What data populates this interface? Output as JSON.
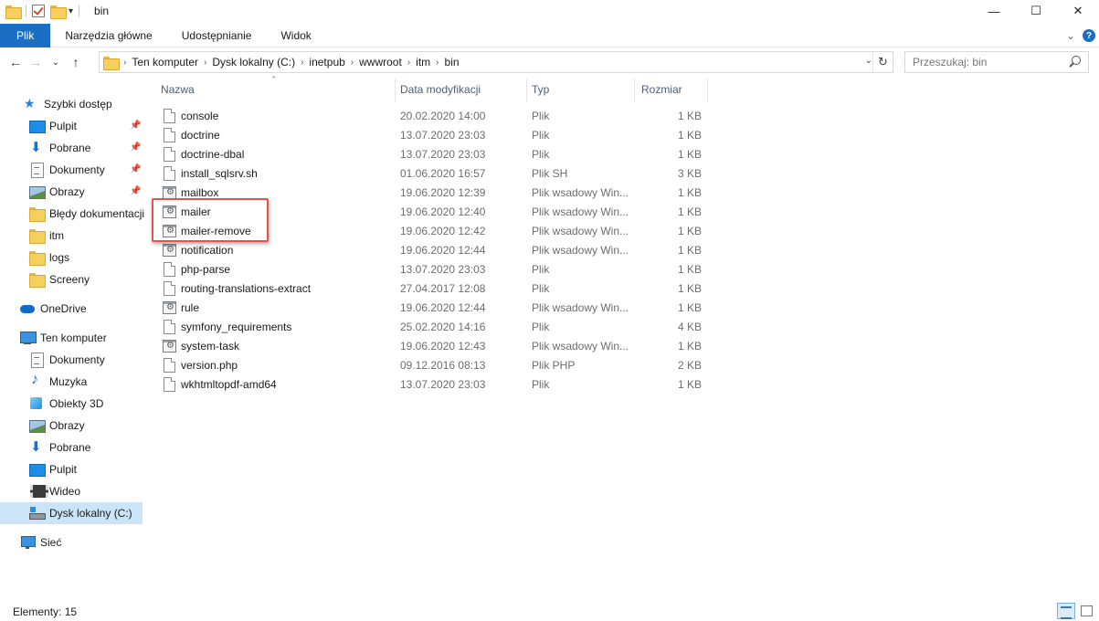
{
  "window": {
    "title": "bin",
    "buttons": {
      "minimize": "—",
      "maximize": "☐",
      "close": "✕"
    }
  },
  "ribbon": {
    "tabs": [
      "Plik",
      "Narzędzia główne",
      "Udostępnianie",
      "Widok"
    ],
    "expand_icon": "⌄",
    "help_icon": "?"
  },
  "nav": {
    "back": "←",
    "forward": "→",
    "recent": "⌄",
    "up": "↑"
  },
  "address": {
    "crumbs": [
      "Ten komputer",
      "Dysk lokalny (C:)",
      "inetpub",
      "wwwroot",
      "itm",
      "bin"
    ],
    "separator": "›",
    "dropdown": "⌄",
    "refresh": "↻"
  },
  "search": {
    "placeholder": "Przeszukaj: bin"
  },
  "sidebar": {
    "quick_access": "Szybki dostęp",
    "quick_items": [
      {
        "label": "Pulpit",
        "icon": "desktop-icon",
        "pinned": true
      },
      {
        "label": "Pobrane",
        "icon": "downloads-icon",
        "pinned": true
      },
      {
        "label": "Dokumenty",
        "icon": "documents-icon",
        "pinned": true
      },
      {
        "label": "Obrazy",
        "icon": "pictures-icon",
        "pinned": true
      },
      {
        "label": "Błędy dokumentacji",
        "icon": "folder-icon",
        "pinned": false
      },
      {
        "label": "itm",
        "icon": "folder-icon",
        "pinned": false
      },
      {
        "label": "logs",
        "icon": "folder-icon",
        "pinned": false
      },
      {
        "label": "Screeny",
        "icon": "folder-icon",
        "pinned": false
      }
    ],
    "onedrive": "OneDrive",
    "this_pc": "Ten komputer",
    "pc_items": [
      {
        "label": "Dokumenty",
        "icon": "documents-icon"
      },
      {
        "label": "Muzyka",
        "icon": "music-icon"
      },
      {
        "label": "Obiekty 3D",
        "icon": "3d-objects-icon"
      },
      {
        "label": "Obrazy",
        "icon": "pictures-icon"
      },
      {
        "label": "Pobrane",
        "icon": "downloads-icon"
      },
      {
        "label": "Pulpit",
        "icon": "desktop-icon"
      },
      {
        "label": "Wideo",
        "icon": "video-icon"
      },
      {
        "label": "Dysk lokalny (C:)",
        "icon": "drive-icon"
      }
    ],
    "network": "Sieć",
    "pin_glyph": "📌"
  },
  "columns": {
    "name": "Nazwa",
    "date": "Data modyfikacji",
    "type": "Typ",
    "size": "Rozmiar"
  },
  "files": [
    {
      "name": "console",
      "date": "20.02.2020 14:00",
      "type": "Plik",
      "size": "1 KB",
      "kind": "file"
    },
    {
      "name": "doctrine",
      "date": "13.07.2020 23:03",
      "type": "Plik",
      "size": "1 KB",
      "kind": "file"
    },
    {
      "name": "doctrine-dbal",
      "date": "13.07.2020 23:03",
      "type": "Plik",
      "size": "1 KB",
      "kind": "file"
    },
    {
      "name": "install_sqlsrv.sh",
      "date": "01.06.2020 16:57",
      "type": "Plik SH",
      "size": "3 KB",
      "kind": "file"
    },
    {
      "name": "mailbox",
      "date": "19.06.2020 12:39",
      "type": "Plik wsadowy Win...",
      "size": "1 KB",
      "kind": "batch"
    },
    {
      "name": "mailer",
      "date": "19.06.2020 12:40",
      "type": "Plik wsadowy Win...",
      "size": "1 KB",
      "kind": "batch"
    },
    {
      "name": "mailer-remove",
      "date": "19.06.2020 12:42",
      "type": "Plik wsadowy Win...",
      "size": "1 KB",
      "kind": "batch"
    },
    {
      "name": "notification",
      "date": "19.06.2020 12:44",
      "type": "Plik wsadowy Win...",
      "size": "1 KB",
      "kind": "batch"
    },
    {
      "name": "php-parse",
      "date": "13.07.2020 23:03",
      "type": "Plik",
      "size": "1 KB",
      "kind": "file"
    },
    {
      "name": "routing-translations-extract",
      "date": "27.04.2017 12:08",
      "type": "Plik",
      "size": "1 KB",
      "kind": "file"
    },
    {
      "name": "rule",
      "date": "19.06.2020 12:44",
      "type": "Plik wsadowy Win...",
      "size": "1 KB",
      "kind": "batch"
    },
    {
      "name": "symfony_requirements",
      "date": "25.02.2020 14:16",
      "type": "Plik",
      "size": "4 KB",
      "kind": "file"
    },
    {
      "name": "system-task",
      "date": "19.06.2020 12:43",
      "type": "Plik wsadowy Win...",
      "size": "1 KB",
      "kind": "batch"
    },
    {
      "name": "version.php",
      "date": "09.12.2016 08:13",
      "type": "Plik PHP",
      "size": "2 KB",
      "kind": "file"
    },
    {
      "name": "wkhtmltopdf-amd64",
      "date": "13.07.2020 23:03",
      "type": "Plik",
      "size": "1 KB",
      "kind": "file"
    }
  ],
  "status": {
    "items": "Elementy: 15"
  },
  "colors": {
    "accent": "#1a6fc4",
    "highlight_box": "#e0564a",
    "selected_bg": "#cce4f7"
  }
}
